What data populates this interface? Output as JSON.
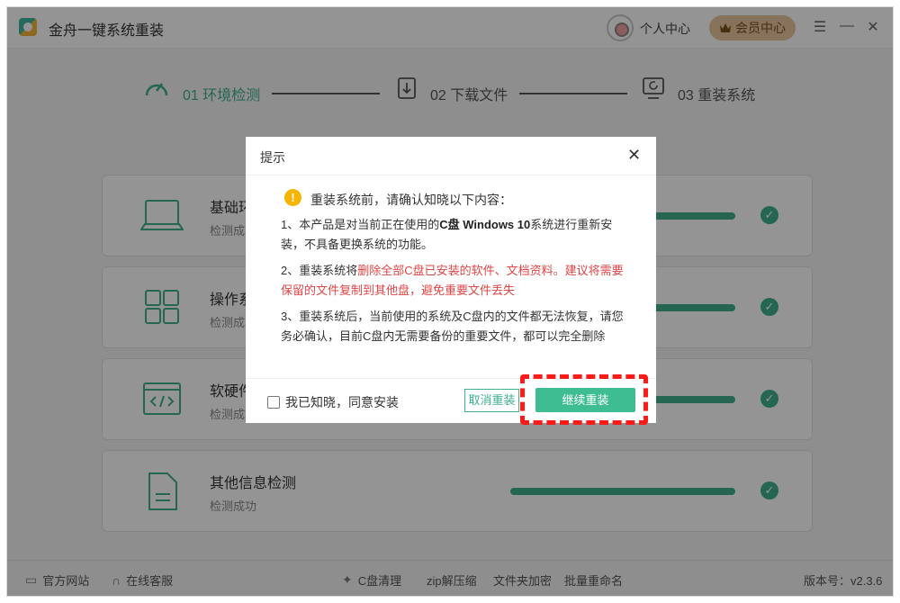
{
  "app": {
    "title": "金舟一键系统重装",
    "user_center": "个人中心",
    "vip_label": "会员中心"
  },
  "steps": [
    {
      "label": "01 环境检测",
      "state": "active"
    },
    {
      "label": "02 下载文件",
      "state": "pending"
    },
    {
      "label": "03 重装系统",
      "state": "pending"
    }
  ],
  "panels": [
    {
      "title": "基础环境检测",
      "status": "检测成功"
    },
    {
      "title": "操作系统检测",
      "status": "检测成功"
    },
    {
      "title": "软硬件检测",
      "status": "检测成功"
    },
    {
      "title": "其他信息检测",
      "status": "检测成功"
    }
  ],
  "footer": {
    "website": "官方网站",
    "support": "在线客服",
    "tools": [
      "C盘清理",
      "zip解压缩",
      "文件夹加密",
      "批量重命名"
    ],
    "version": "版本号：v2.3.6"
  },
  "dialog": {
    "title": "提示",
    "warning_title": "重装系统前，请确认知晓以下内容：",
    "item1_pre": "1、本产品是对当前正在使用的",
    "item1_bold": "C盘 Windows 10",
    "item1_post": "系统进行重新安装，不具备更换系统的功能。",
    "item2_pre": "2、重装系统将",
    "item2_red": "删除全部C盘已安装的软件、文档资料。建议将需要保留的文件复制到其他盘，避免重要文件丢失",
    "item3": "3、重装系统后，当前使用的系统及C盘内的文件都无法恢复，请您务必确认，目前C盘内无需要备份的重要文件，都可以完全删除",
    "agree_label": "我已知晓，同意安装",
    "cancel_label": "取消重装",
    "continue_label": "继续重装"
  },
  "colors": {
    "accent": "#3eb08e",
    "warning": "#e04545",
    "vip": "#e8c79f",
    "highlight": "#ff1a1a"
  }
}
